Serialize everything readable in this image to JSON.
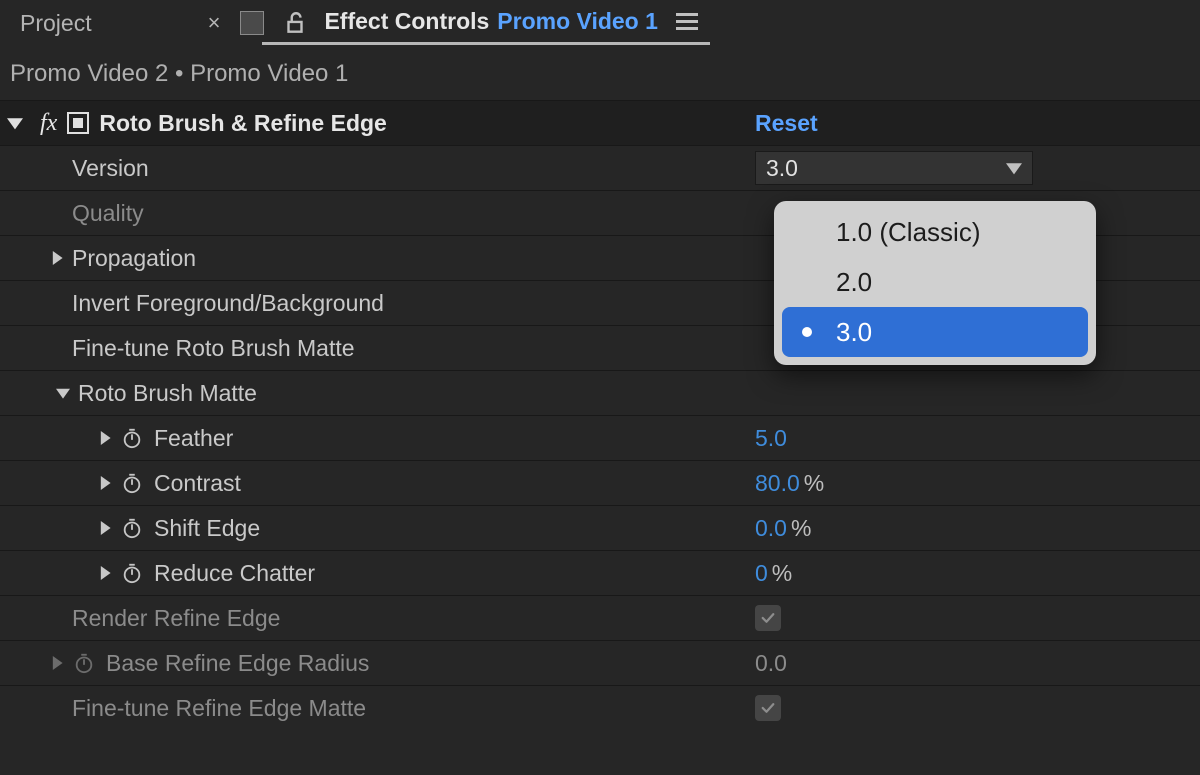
{
  "tabs": {
    "project_label": "Project",
    "effect_controls_label": "Effect Controls",
    "comp_name": "Promo Video 1"
  },
  "breadcrumb": {
    "parent": "Promo Video 2",
    "separator": " • ",
    "current": "Promo Video 1"
  },
  "effect": {
    "fx_glyph": "fx",
    "title": "Roto Brush & Refine Edge",
    "reset": "Reset"
  },
  "props": {
    "version": {
      "label": "Version",
      "value": "3.0"
    },
    "quality": {
      "label": "Quality"
    },
    "propagation": {
      "label": "Propagation"
    },
    "invert_fg_bg": {
      "label": "Invert Foreground/Background"
    },
    "fine_tune_roto": {
      "label": "Fine-tune Roto Brush Matte"
    },
    "roto_brush_matte": {
      "label": "Roto Brush Matte"
    },
    "feather": {
      "label": "Feather",
      "value": "5.0"
    },
    "contrast": {
      "label": "Contrast",
      "value": "80.0",
      "unit": "%"
    },
    "shift_edge": {
      "label": "Shift Edge",
      "value": "0.0",
      "unit": "%"
    },
    "reduce_chatter": {
      "label": "Reduce Chatter",
      "value": "0",
      "unit": "%"
    },
    "render_refine_edge": {
      "label": "Render Refine Edge",
      "checked": true
    },
    "base_refine_edge_radius": {
      "label": "Base Refine Edge Radius",
      "value": "0.0"
    },
    "fine_tune_refine_edge_matte": {
      "label": "Fine-tune Refine Edge Matte",
      "checked": true
    }
  },
  "version_dropdown": {
    "options": [
      "1.0 (Classic)",
      "2.0",
      "3.0"
    ],
    "selected_index": 2
  }
}
